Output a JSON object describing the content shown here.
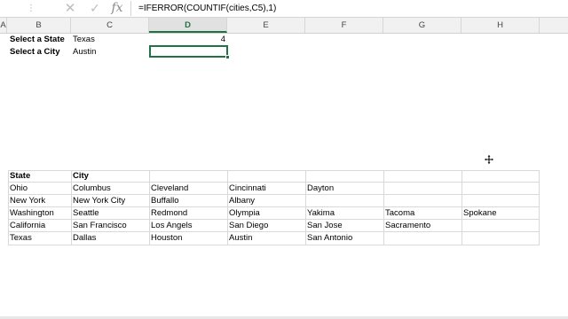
{
  "formula_bar": {
    "cancel_icon": "✕",
    "enter_icon": "✓",
    "fx_label": "fx",
    "formula": "=IFERROR(COUNTIF(cities,C5),1)"
  },
  "columns": [
    "A",
    "B",
    "C",
    "D",
    "E",
    "F",
    "G",
    "H"
  ],
  "selected_column": "D",
  "selectors": {
    "state_label": "Select a State",
    "state_value": "Texas",
    "state_count": "4",
    "city_label": "Select a City",
    "city_value": "Austin"
  },
  "table": {
    "headers": [
      "State",
      "City"
    ],
    "rows": [
      {
        "state": "Ohio",
        "cities": [
          "Columbus",
          "Cleveland",
          "Cincinnati",
          "Dayton",
          "",
          ""
        ]
      },
      {
        "state": "New York",
        "cities": [
          "New York City",
          "Buffallo",
          "Albany",
          "",
          "",
          ""
        ]
      },
      {
        "state": "Washington",
        "cities": [
          "Seattle",
          "Redmond",
          "Olympia",
          "Yakima",
          "Tacoma",
          "Spokane"
        ]
      },
      {
        "state": "California",
        "cities": [
          "San Francisco",
          "Los Angels",
          "San Diego",
          "San Jose",
          "Sacramento",
          ""
        ]
      },
      {
        "state": "Texas",
        "cities": [
          "Dallas",
          "Houston",
          "Austin",
          "San Antonio",
          "",
          ""
        ]
      }
    ]
  },
  "accent_color": "#217346",
  "cursor_icon": "move-cursor-icon"
}
